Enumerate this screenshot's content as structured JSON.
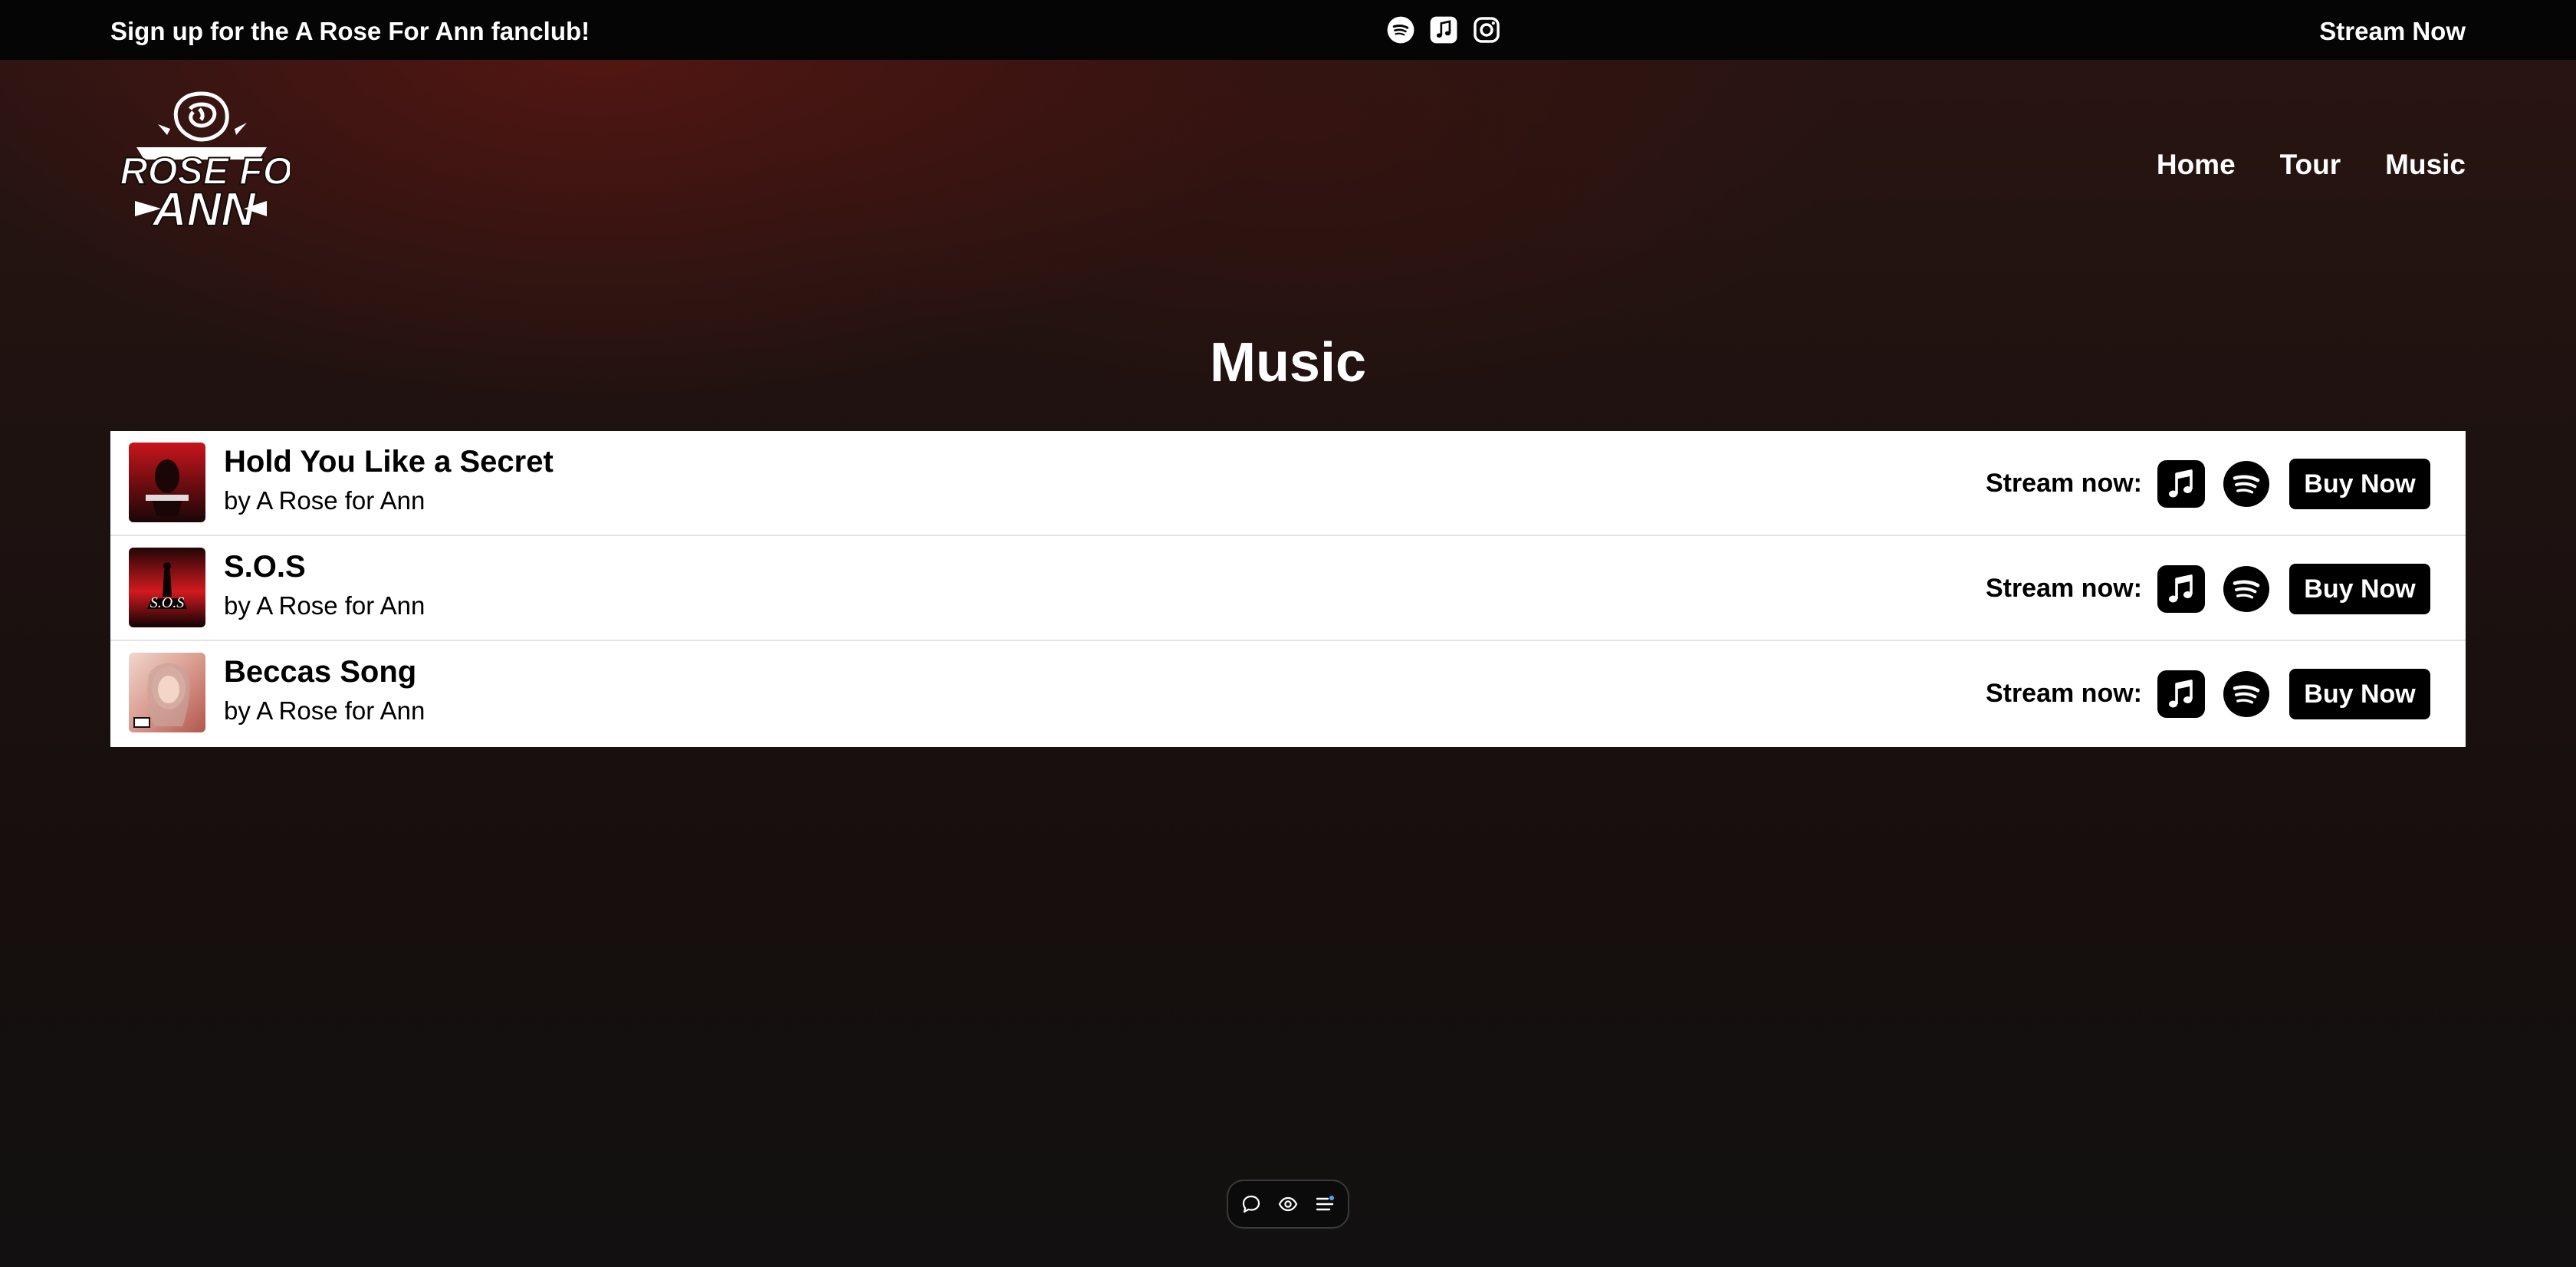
{
  "topbar": {
    "signup_text": "Sign up for the A Rose For Ann fanclub!",
    "social_icons": [
      "spotify-icon",
      "apple-music-icon",
      "instagram-icon"
    ],
    "stream_now": "Stream Now"
  },
  "header": {
    "logo_text": "A ROSE FOR ANN",
    "nav": [
      {
        "label": "Home"
      },
      {
        "label": "Tour"
      },
      {
        "label": "Music"
      }
    ]
  },
  "main": {
    "title": "Music",
    "tracks": [
      {
        "title": "Hold You Like a Secret",
        "artist": "by A Rose for Ann",
        "stream_label": "Stream now:",
        "buy_label": "Buy Now"
      },
      {
        "title": "S.O.S",
        "artist": "by A Rose for Ann",
        "stream_label": "Stream now:",
        "buy_label": "Buy Now"
      },
      {
        "title": "Beccas Song",
        "artist": "by A Rose for Ann",
        "stream_label": "Stream now:",
        "buy_label": "Buy Now"
      }
    ]
  },
  "floating_toolbar": {
    "icons": [
      "comment-icon",
      "eye-icon",
      "list-icon"
    ]
  },
  "colors": {
    "background": "#1e1210",
    "background_glow": "#781612",
    "topbar": "#050505",
    "card": "#ffffff",
    "button": "#000000",
    "text_light": "#ffffff",
    "text_dark": "#000000"
  }
}
